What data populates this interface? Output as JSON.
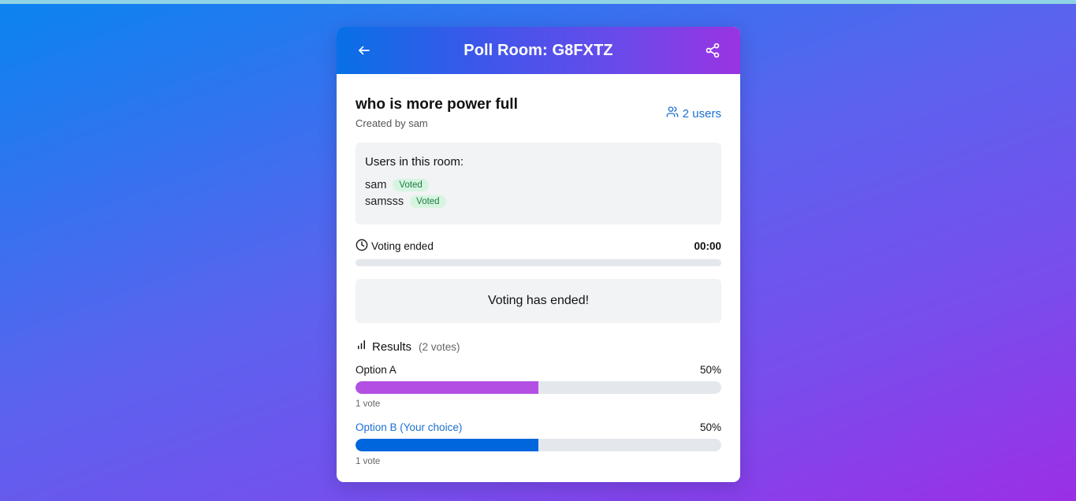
{
  "header": {
    "title": "Poll Room: G8FXTZ",
    "back_icon": "arrow-left-icon",
    "share_icon": "share-icon"
  },
  "poll": {
    "question": "who is more power full",
    "creator": "Created by sam",
    "users_count_label": "2 users"
  },
  "users_box": {
    "title": "Users in this room:",
    "users": [
      {
        "name": "sam",
        "status": "Voted"
      },
      {
        "name": "samsss",
        "status": "Voted"
      }
    ]
  },
  "timer": {
    "label": "Voting ended",
    "value": "00:00",
    "progress": 0
  },
  "ended_message": "Voting has ended!",
  "results": {
    "title": "Results",
    "total_votes": "(2 votes)",
    "options": [
      {
        "label": "Option A",
        "percent_label": "50%",
        "percent": 50,
        "votes_label": "1 vote",
        "color": "#b34fe3",
        "is_choice": false
      },
      {
        "label": "Option B (Your choice)",
        "percent_label": "50%",
        "percent": 50,
        "votes_label": "1 vote",
        "color": "#0066dd",
        "is_choice": true
      }
    ]
  },
  "colors": {
    "accent": "#1a6fd1",
    "voted_badge_bg": "#d6f5e0",
    "voted_badge_text": "#1d7a41"
  }
}
